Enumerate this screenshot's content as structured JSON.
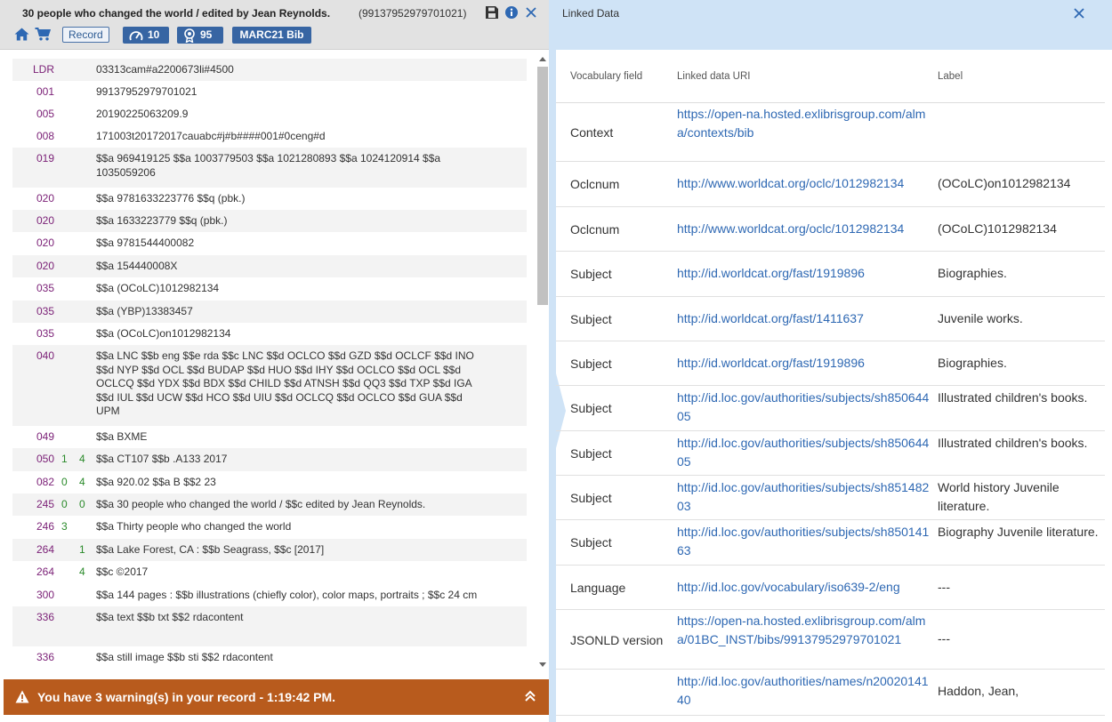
{
  "left": {
    "title": "30 people who changed the world / edited by Jean Reynolds.",
    "record_id": "(99137952979701021)",
    "record_badge": "Record",
    "speed_count": "10",
    "award_count": "95",
    "format_badge": "MARC21 Bib",
    "marc_fields": [
      {
        "tag": "LDR",
        "i1": "",
        "i2": "",
        "content": "03313cam#a2200673li#4500"
      },
      {
        "tag": "001",
        "i1": "",
        "i2": "",
        "content": "99137952979701021"
      },
      {
        "tag": "005",
        "i1": "",
        "i2": "",
        "content": "20190225063209.9"
      },
      {
        "tag": "008",
        "i1": "",
        "i2": "",
        "content": "171003t20172017cauabc#j#b####001#0ceng#d"
      },
      {
        "tag": "019",
        "i1": "",
        "i2": "",
        "content": "$$a 969419125 $$a 1003779503 $$a 1021280893 $$a 1024120914 $$a 1035059206"
      },
      {
        "tag": "020",
        "i1": "",
        "i2": "",
        "content": "$$a 9781633223776 $$q (pbk.)"
      },
      {
        "tag": "020",
        "i1": "",
        "i2": "",
        "content": "$$a 1633223779 $$q (pbk.)"
      },
      {
        "tag": "020",
        "i1": "",
        "i2": "",
        "content": "$$a 9781544400082"
      },
      {
        "tag": "020",
        "i1": "",
        "i2": "",
        "content": "$$a 154440008X"
      },
      {
        "tag": "035",
        "i1": "",
        "i2": "",
        "content": "$$a (OCoLC)1012982134"
      },
      {
        "tag": "035",
        "i1": "",
        "i2": "",
        "content": "$$a (YBP)13383457"
      },
      {
        "tag": "035",
        "i1": "",
        "i2": "",
        "content": "$$a (OCoLC)on1012982134"
      },
      {
        "tag": "040",
        "i1": "",
        "i2": "",
        "content": "$$a LNC $$b eng $$e rda $$c LNC $$d OCLCO $$d GZD $$d OCLCF $$d INO $$d NYP $$d OCL $$d BUDAP $$d HUO $$d IHY $$d OCLCO $$d OCL $$d OCLCQ $$d YDX $$d BDX $$d CHILD $$d ATNSH $$d QQ3 $$d TXP $$d IGA $$d IUL $$d UCW $$d HCO $$d UIU $$d OCLCQ $$d OCLCO $$d GUA $$d UPM"
      },
      {
        "tag": "049",
        "i1": "",
        "i2": "",
        "content": "$$a BXME"
      },
      {
        "tag": "050",
        "i1": "1",
        "i2": "4",
        "content": "$$a CT107 $$b .A133 2017"
      },
      {
        "tag": "082",
        "i1": "0",
        "i2": "4",
        "content": "$$a 920.02 $$a B $$2 23"
      },
      {
        "tag": "245",
        "i1": "0",
        "i2": "0",
        "content": "$$a 30 people who changed the world / $$c edited by Jean Reynolds."
      },
      {
        "tag": "246",
        "i1": "3",
        "i2": "",
        "content": "$$a Thirty people who changed the world"
      },
      {
        "tag": "264",
        "i1": "",
        "i2": "1",
        "content": "$$a Lake Forest, CA : $$b Seagrass, $$c [2017]"
      },
      {
        "tag": "264",
        "i1": "",
        "i2": "4",
        "content": "$$c ©2017"
      },
      {
        "tag": "300",
        "i1": "",
        "i2": "",
        "content": "$$a 144 pages : $$b illustrations (chiefly color), color maps, portraits ; $$c 24 cm"
      },
      {
        "tag": "336",
        "i1": "",
        "i2": "",
        "content": "$$a text $$b txt $$2 rdacontent"
      },
      {
        "tag": "336",
        "i1": "",
        "i2": "",
        "content": "$$a still image $$b sti $$2 rdacontent"
      }
    ],
    "warning": "You have 3 warning(s) in your record - 1:19:42 PM."
  },
  "right": {
    "title": "Linked Data",
    "columns": [
      "Vocabulary field",
      "Linked data URI",
      "Label"
    ],
    "rows": [
      {
        "field": "Context",
        "uri": "https://open-na.hosted.exlibrisgroup.com/alma/contexts/bib",
        "label": ""
      },
      {
        "field": "Oclcnum",
        "uri": "http://www.worldcat.org/oclc/1012982134",
        "label": "(OCoLC)on1012982134"
      },
      {
        "field": "Oclcnum",
        "uri": "http://www.worldcat.org/oclc/1012982134",
        "label": "(OCoLC)1012982134"
      },
      {
        "field": "Subject",
        "uri": "http://id.worldcat.org/fast/1919896",
        "label": "Biographies."
      },
      {
        "field": "Subject",
        "uri": "http://id.worldcat.org/fast/1411637",
        "label": "Juvenile works."
      },
      {
        "field": "Subject",
        "uri": "http://id.worldcat.org/fast/1919896",
        "label": "Biographies."
      },
      {
        "field": "Subject",
        "uri": "http://id.loc.gov/authorities/subjects/sh85064405",
        "label": "Illustrated children's books."
      },
      {
        "field": "Subject",
        "uri": "http://id.loc.gov/authorities/subjects/sh85064405",
        "label": "Illustrated children's books."
      },
      {
        "field": "Subject",
        "uri": "http://id.loc.gov/authorities/subjects/sh85148203",
        "label": "World history Juvenile literature."
      },
      {
        "field": "Subject",
        "uri": "http://id.loc.gov/authorities/subjects/sh85014163",
        "label": "Biography Juvenile literature."
      },
      {
        "field": "Language",
        "uri": "http://id.loc.gov/vocabulary/iso639-2/eng",
        "label": "---"
      },
      {
        "field": "JSONLD version",
        "uri": "https://open-na.hosted.exlibrisgroup.com/alma/01BC_INST/bibs/99137952979701021",
        "label": "---"
      },
      {
        "field": "",
        "uri": "http://id.loc.gov/authorities/names/n2002014140",
        "label": "Haddon, Jean,"
      }
    ]
  },
  "colors": {
    "header_gray": "#e2e2e2",
    "badge_blue": "#3765a3",
    "tag_purple": "#7a1f76",
    "indicator_green": "#2a8a2a",
    "warning_orange": "#b85b1d",
    "linked_blue": "#cfe3f6",
    "link_blue": "#2e68b3"
  },
  "icons": [
    "save-icon",
    "info-icon",
    "close-icon",
    "home-icon",
    "cart-icon",
    "speedometer-icon",
    "award-icon",
    "warning-icon",
    "chevron-double-up-icon"
  ]
}
